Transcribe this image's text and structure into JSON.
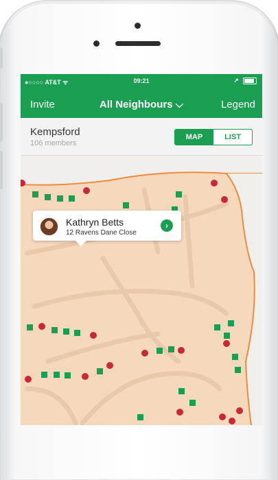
{
  "status": {
    "carrier": "●○○○○ AT&T ᯤ",
    "time": "09:21"
  },
  "nav": {
    "left": "Invite",
    "title": "All Neighbours ⌵",
    "right": "Legend"
  },
  "header": {
    "place": "Kempsford",
    "members": "106 members"
  },
  "toggle": {
    "map": "MAP",
    "list": "LIST",
    "selected": "MAP"
  },
  "popup": {
    "name": "Kathryn Betts",
    "address": "12 Ravens Dane Close"
  },
  "colors": {
    "brand": "#1a9e51",
    "red_marker": "#c8283a",
    "map_land": "#f6d9bd",
    "boundary": "#f08a3c"
  },
  "icons": [
    "wifi-icon",
    "location-arrow-icon",
    "battery-icon",
    "chevron-right-icon",
    "avatar-icon"
  ]
}
